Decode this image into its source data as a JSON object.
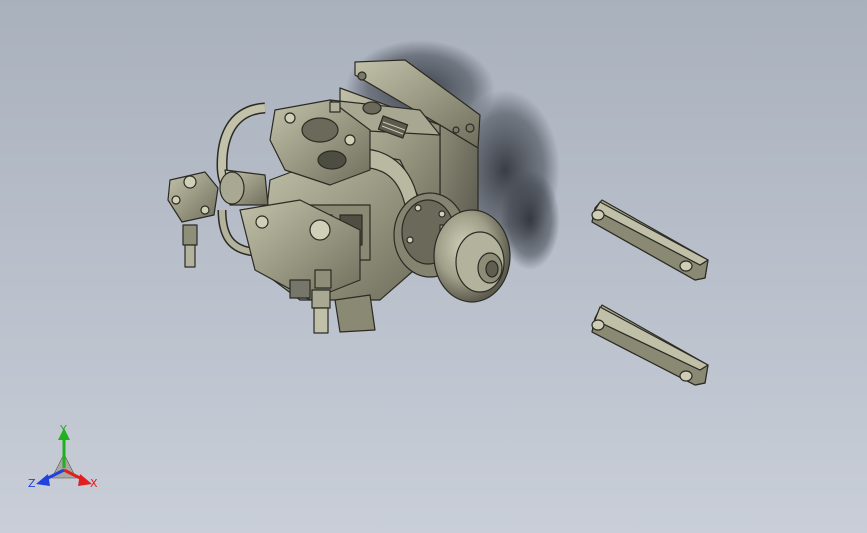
{
  "viewport": {
    "background_top": "#a9b1bd",
    "background_bottom": "#c9ced8"
  },
  "model": {
    "part_color": "#9a9983",
    "edge_color": "#2b2b24",
    "shadow_color": "#3f444d"
  },
  "triad": {
    "x_label": "X",
    "y_label": "Y",
    "z_label": "Z",
    "x_color": "#e02020",
    "y_color": "#20b020",
    "z_color": "#2040e0"
  }
}
